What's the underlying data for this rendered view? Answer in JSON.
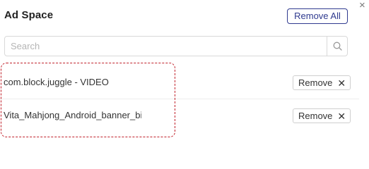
{
  "dialog": {
    "title": "Ad Space",
    "close_glyph": "×",
    "remove_all_label": "Remove All"
  },
  "search": {
    "placeholder": "Search",
    "value": "",
    "icon": "search-icon"
  },
  "rows": [
    {
      "name": "com.block.juggle - VIDEO",
      "remove_label": "Remove",
      "remove_icon": "close-icon"
    },
    {
      "name": "Vita_Mahjong_Android_banner_bi",
      "remove_label": "Remove",
      "remove_icon": "close-icon"
    }
  ],
  "colors": {
    "accent": "#2f3a8f",
    "highlight": "#c0202a",
    "border": "#d9d9d9"
  }
}
